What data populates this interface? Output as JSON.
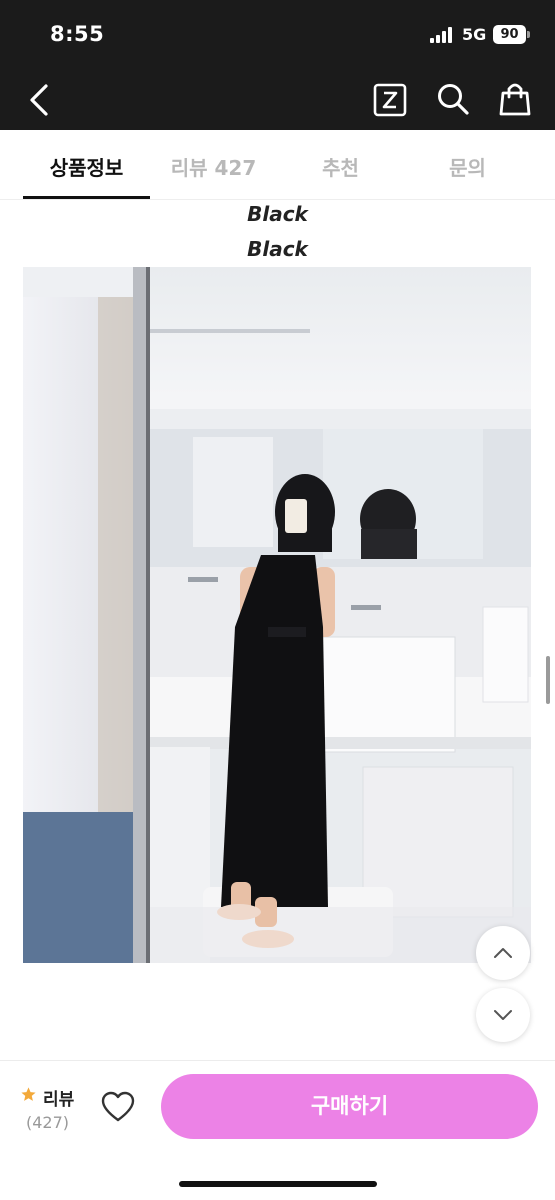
{
  "status_bar": {
    "time": "8:55",
    "network": "5G",
    "battery": "90"
  },
  "header": {
    "back_icon": "chevron-left-icon",
    "z_icon": "z-logo-icon",
    "search_icon": "search-icon",
    "bag_icon": "shopping-bag-icon"
  },
  "tabs": [
    {
      "label": "상품정보",
      "active": true
    },
    {
      "label": "리뷰 427",
      "active": false
    },
    {
      "label": "추천",
      "active": false
    },
    {
      "label": "문의",
      "active": false
    }
  ],
  "content": {
    "variant_labels": [
      "Black",
      "Black"
    ],
    "photo_icon": "product-photo"
  },
  "floating_buttons": {
    "up_icon": "chevron-up-icon",
    "down_icon": "chevron-down-icon"
  },
  "bottom_bar": {
    "review_label": "리뷰",
    "review_count": "(427)",
    "star_icon": "star-icon",
    "heart_icon": "heart-icon",
    "buy_label": "구매하기",
    "buy_color": "#ec82e6"
  }
}
